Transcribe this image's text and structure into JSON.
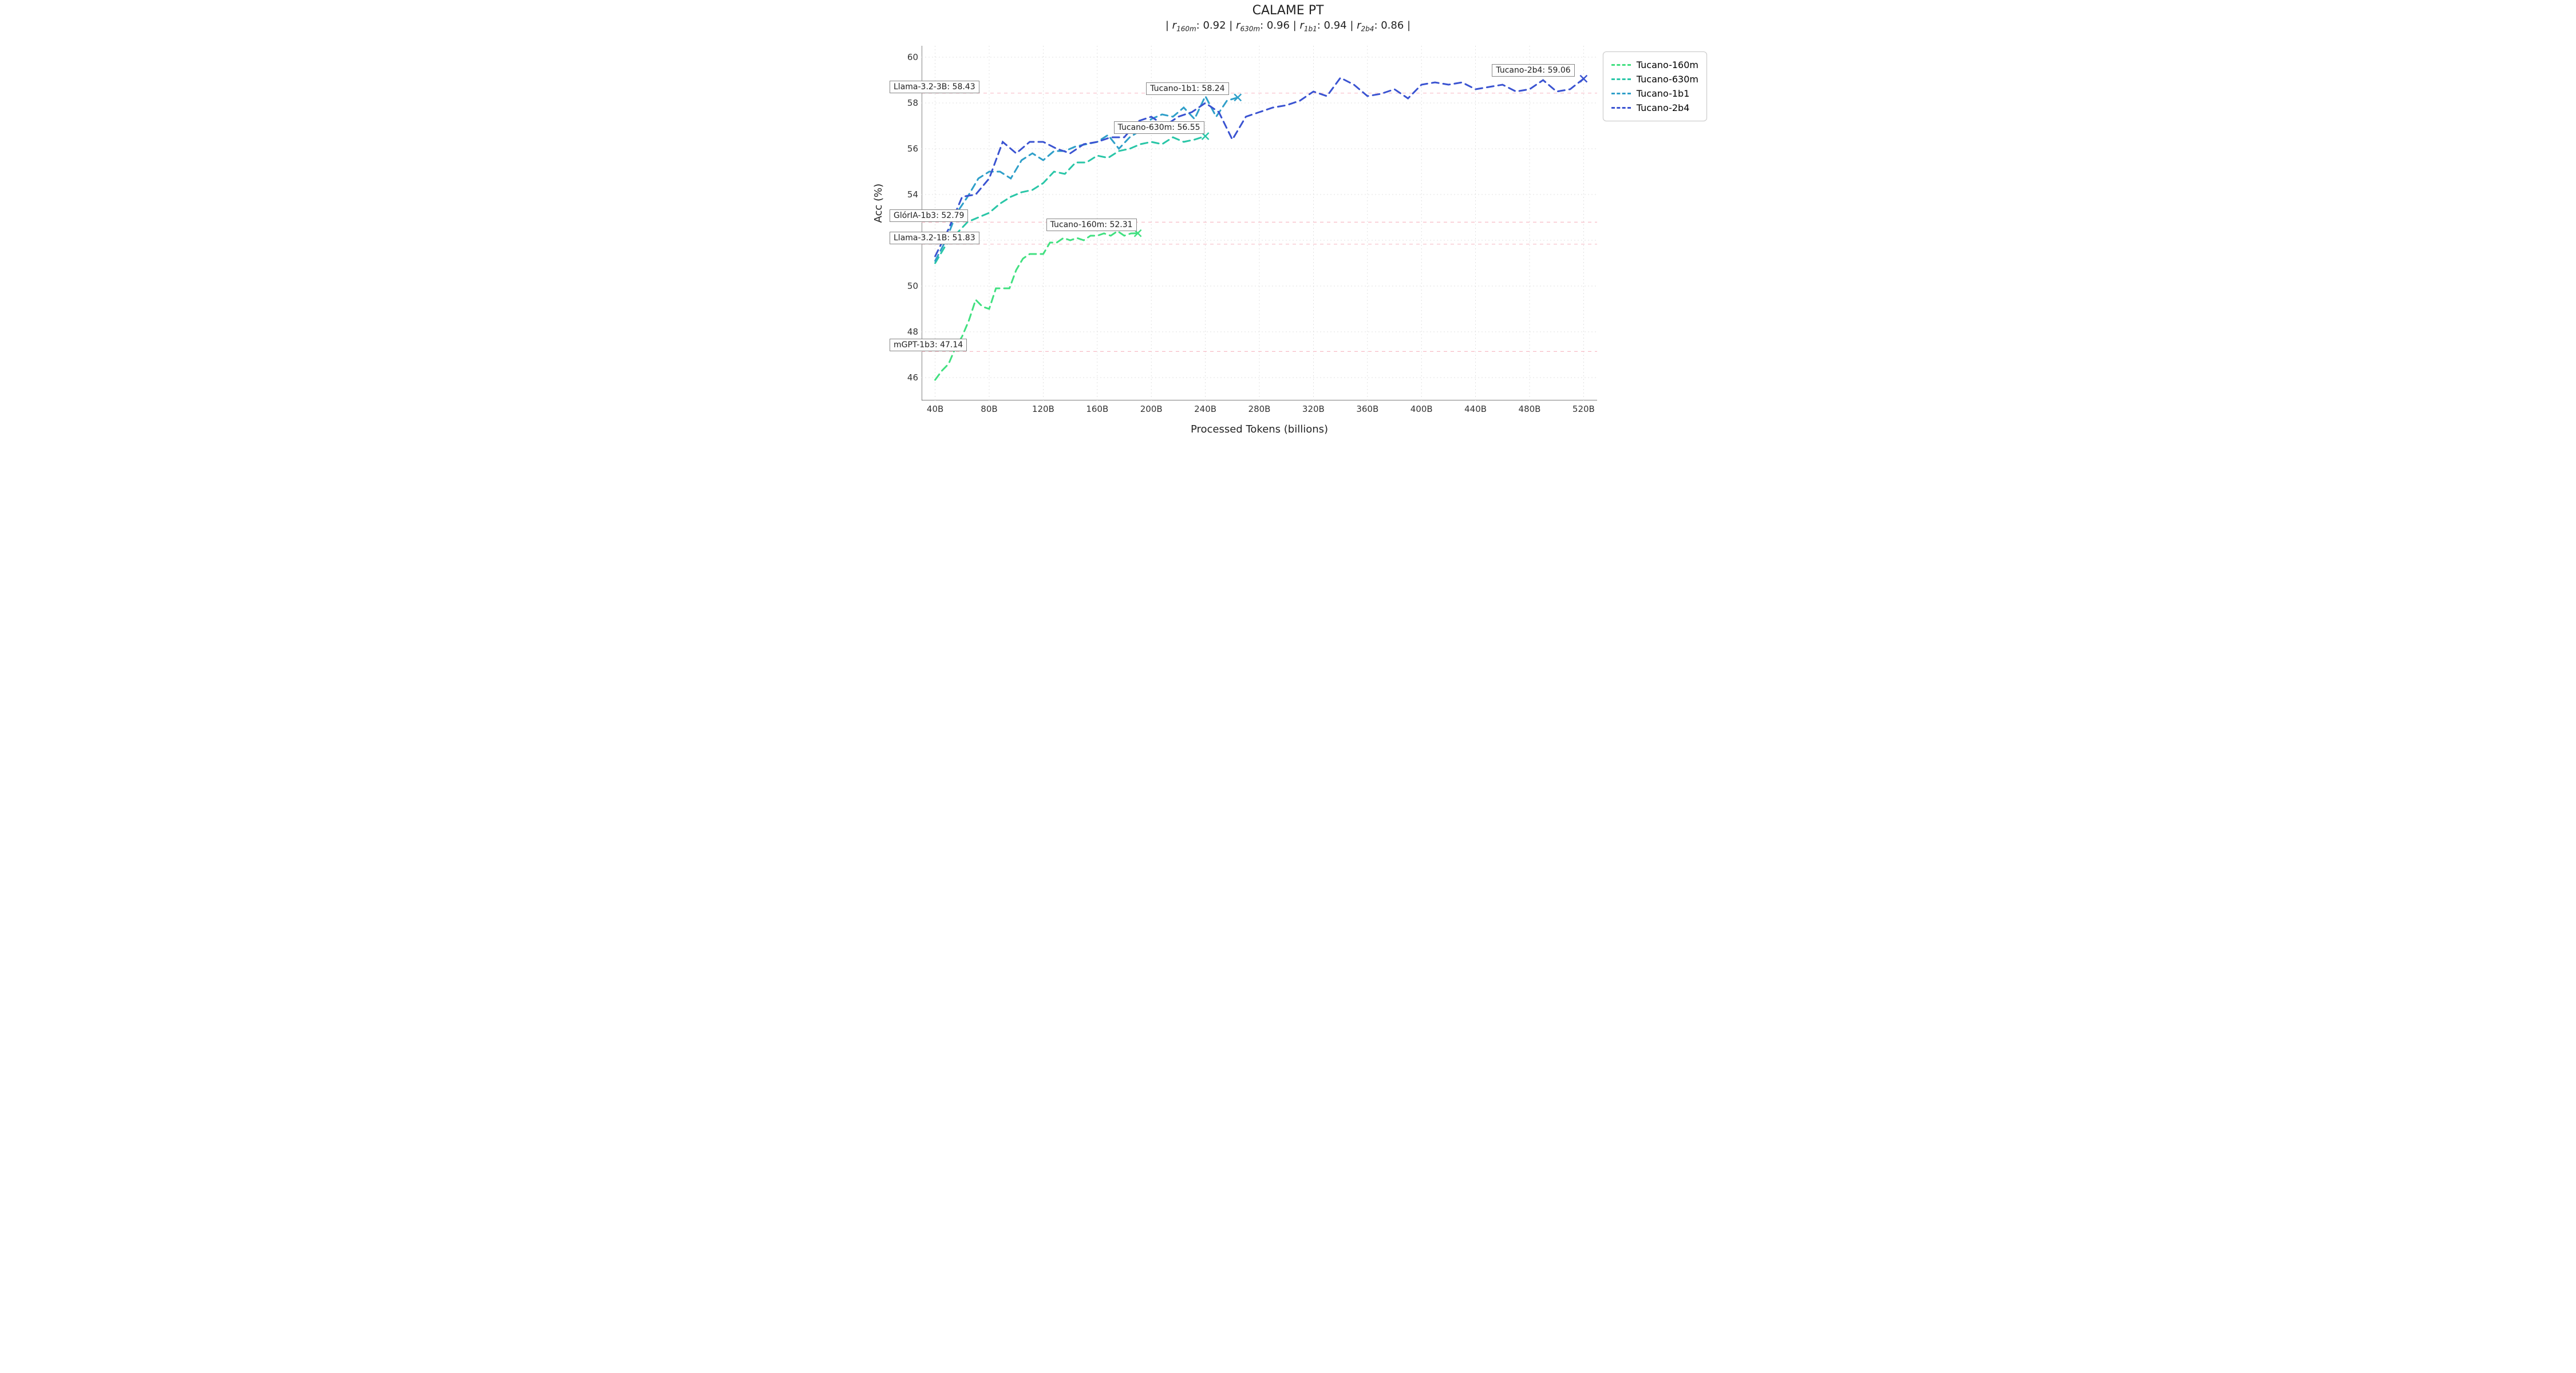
{
  "chart_data": {
    "type": "line",
    "title": "CALAME PT",
    "subtitle_parts": {
      "r160m": "0.92",
      "r630m": "0.96",
      "r1b1": "0.94",
      "r2b4": "0.86"
    },
    "xlabel": "Processed Tokens (billions)",
    "ylabel": "Acc (%)",
    "xlim": [
      30,
      530
    ],
    "ylim": [
      45,
      60.5
    ],
    "xticks": [
      40,
      80,
      120,
      160,
      200,
      240,
      280,
      320,
      360,
      400,
      440,
      480,
      520
    ],
    "xtick_labels": [
      "40B",
      "80B",
      "120B",
      "160B",
      "200B",
      "240B",
      "280B",
      "320B",
      "360B",
      "400B",
      "440B",
      "480B",
      "520B"
    ],
    "yticks": [
      46,
      48,
      50,
      52,
      54,
      56,
      58,
      60
    ],
    "series": [
      {
        "name": "Tucano-160m",
        "color": "#41e080",
        "x": [
          40,
          45,
          50,
          55,
          60,
          65,
          70,
          75,
          80,
          85,
          90,
          95,
          100,
          105,
          110,
          115,
          120,
          125,
          130,
          135,
          140,
          145,
          150,
          155,
          160,
          165,
          170,
          175,
          180,
          185,
          190
        ],
        "values": [
          45.9,
          46.3,
          46.6,
          47.3,
          47.8,
          48.5,
          49.4,
          49.1,
          49.0,
          49.9,
          49.9,
          49.9,
          50.7,
          51.2,
          51.4,
          51.4,
          51.4,
          51.9,
          51.9,
          52.1,
          52.0,
          52.1,
          52.0,
          52.2,
          52.2,
          52.3,
          52.2,
          52.4,
          52.2,
          52.3,
          52.31
        ],
        "end_label": "Tucano-160m: 52.31",
        "end_marker": "x"
      },
      {
        "name": "Tucano-630m",
        "color": "#29c6a7",
        "x": [
          40,
          48,
          56,
          64,
          72,
          80,
          88,
          96,
          104,
          112,
          120,
          128,
          136,
          144,
          152,
          160,
          168,
          176,
          184,
          192,
          200,
          208,
          216,
          224,
          232,
          240
        ],
        "values": [
          51.0,
          51.8,
          52.3,
          52.8,
          53.0,
          53.2,
          53.6,
          53.9,
          54.1,
          54.2,
          54.5,
          55.0,
          54.9,
          55.4,
          55.4,
          55.7,
          55.6,
          55.9,
          56.0,
          56.2,
          56.3,
          56.2,
          56.5,
          56.3,
          56.4,
          56.55
        ],
        "end_label": "Tucano-630m: 56.55",
        "end_marker": "x"
      },
      {
        "name": "Tucano-1b1",
        "color": "#2f9fc9",
        "x": [
          40,
          48,
          56,
          64,
          72,
          80,
          88,
          96,
          104,
          112,
          120,
          128,
          136,
          144,
          152,
          160,
          168,
          176,
          184,
          192,
          200,
          208,
          216,
          224,
          232,
          240,
          248,
          256,
          264
        ],
        "values": [
          51.1,
          52.0,
          53.2,
          53.9,
          54.7,
          55.0,
          55.0,
          54.7,
          55.5,
          55.8,
          55.5,
          55.9,
          55.9,
          56.1,
          56.2,
          56.3,
          56.6,
          56.0,
          56.5,
          56.8,
          57.3,
          57.5,
          57.4,
          57.8,
          57.3,
          58.3,
          57.4,
          58.1,
          58.24
        ],
        "end_label": "Tucano-1b1: 58.24",
        "end_marker": "x"
      },
      {
        "name": "Tucano-2b4",
        "color": "#3a53d1",
        "x": [
          40,
          50,
          60,
          70,
          80,
          90,
          100,
          110,
          120,
          130,
          140,
          150,
          160,
          170,
          180,
          190,
          200,
          210,
          220,
          230,
          240,
          250,
          260,
          270,
          280,
          290,
          300,
          310,
          320,
          330,
          340,
          350,
          360,
          370,
          380,
          390,
          400,
          410,
          420,
          430,
          440,
          450,
          460,
          470,
          480,
          490,
          500,
          510,
          520
        ],
        "values": [
          51.3,
          52.5,
          53.9,
          54.0,
          54.7,
          56.3,
          55.8,
          56.3,
          56.3,
          56.0,
          55.8,
          56.2,
          56.3,
          56.5,
          56.5,
          57.2,
          57.4,
          57.0,
          57.4,
          57.6,
          58.0,
          57.6,
          56.4,
          57.4,
          57.6,
          57.8,
          57.9,
          58.1,
          58.5,
          58.3,
          59.1,
          58.8,
          58.3,
          58.4,
          58.6,
          58.2,
          58.8,
          58.9,
          58.8,
          58.9,
          58.6,
          58.7,
          58.8,
          58.5,
          58.6,
          59.0,
          58.5,
          58.6,
          59.06
        ],
        "end_label": "Tucano-2b4: 59.06",
        "end_marker": "x"
      }
    ],
    "hlines": [
      {
        "label": "Llama-3.2-3B: 58.43",
        "y": 58.43
      },
      {
        "label": "GlórIA-1b3: 52.79",
        "y": 52.79
      },
      {
        "label": "Llama-3.2-1B: 51.83",
        "y": 51.83
      },
      {
        "label": "mGPT-1b3: 47.14",
        "y": 47.14
      }
    ],
    "legend": [
      "Tucano-160m",
      "Tucano-630m",
      "Tucano-1b1",
      "Tucano-2b4"
    ]
  }
}
